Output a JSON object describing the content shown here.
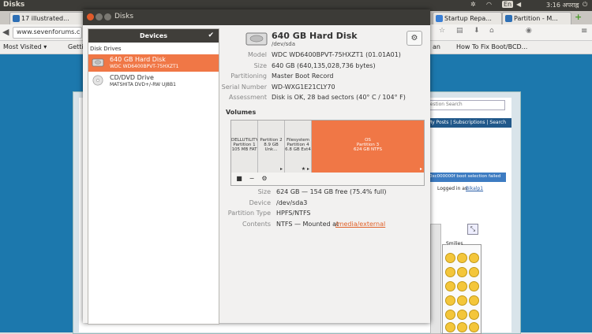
{
  "top_panel": {
    "app_name": "Disks",
    "lang": "En",
    "clock": "3:16 अपराह्न"
  },
  "browser": {
    "tabs": [
      {
        "label": "17 illustrated...",
        "color": "#2d6fb5"
      },
      {
        "label": "Startup Repa...",
        "color": "#3a7fd5"
      },
      {
        "label": "Partition - M...",
        "color": "#2d6fb5"
      }
    ],
    "url": "www.sevenforums.c",
    "bookmarks": [
      {
        "label": "Most Visited ▾"
      },
      {
        "label": "Getti"
      },
      {
        "label": "an"
      },
      {
        "label": "How To Fix Boot/BCD..."
      }
    ],
    "page": {
      "search_placeholder": "uestion Search",
      "links": "My Posts | Subscriptions | Search",
      "alert": "0xc000000f boot selection failed",
      "logged_in_prefix": "Logged in as",
      "logged_in_user": "Bikalp1",
      "smilies_title": "Smilies"
    }
  },
  "window": {
    "title": "Disks",
    "sidebar": {
      "header": "Devices",
      "section": "Disk Drives",
      "drives": [
        {
          "name": "640 GB Hard Disk",
          "sub": "WDC WD6400BPVT-75HXZT1",
          "selected": true
        },
        {
          "name": "CD/DVD Drive",
          "sub": "MATSHITA DVD+/-RW UJ8B1",
          "selected": false
        }
      ]
    },
    "disk": {
      "title": "640 GB Hard Disk",
      "subtitle": "/dev/sda",
      "fields": [
        {
          "label": "Model",
          "value": "WDC WD6400BPVT-75HXZT1 (01.01A01)"
        },
        {
          "label": "Size",
          "value": "640 GB (640,135,028,736 bytes)"
        },
        {
          "label": "Partitioning",
          "value": "Master Boot Record"
        },
        {
          "label": "Serial Number",
          "value": "WD-WXG1E21CLY70"
        },
        {
          "label": "Assessment",
          "value": "Disk is OK, 28 bad sectors (40° C / 104° F)"
        }
      ]
    },
    "volumes": {
      "title": "Volumes",
      "partitions": [
        {
          "line1": "DELLUTILITY",
          "line2": "Partition 1",
          "line3": "105 MB FAT"
        },
        {
          "line1": "",
          "line2": "Partition 2",
          "line3": "8.9 GB Unk..."
        },
        {
          "line1": "Filesystem",
          "line2": "Partition 4",
          "line3": "6.8 GB Ext4"
        },
        {
          "line1": "OS",
          "line2": "Partition 3",
          "line3": "624 GB NTFS"
        }
      ],
      "details": [
        {
          "label": "Size",
          "value": "624 GB — 154 GB free (75.4% full)"
        },
        {
          "label": "Device",
          "value": "/dev/sda3"
        },
        {
          "label": "Partition Type",
          "value": "HPFS/NTFS"
        },
        {
          "label": "Contents",
          "value": "NTFS — Mounted at",
          "link": "/media/external"
        }
      ]
    },
    "accent": "#f07746"
  }
}
